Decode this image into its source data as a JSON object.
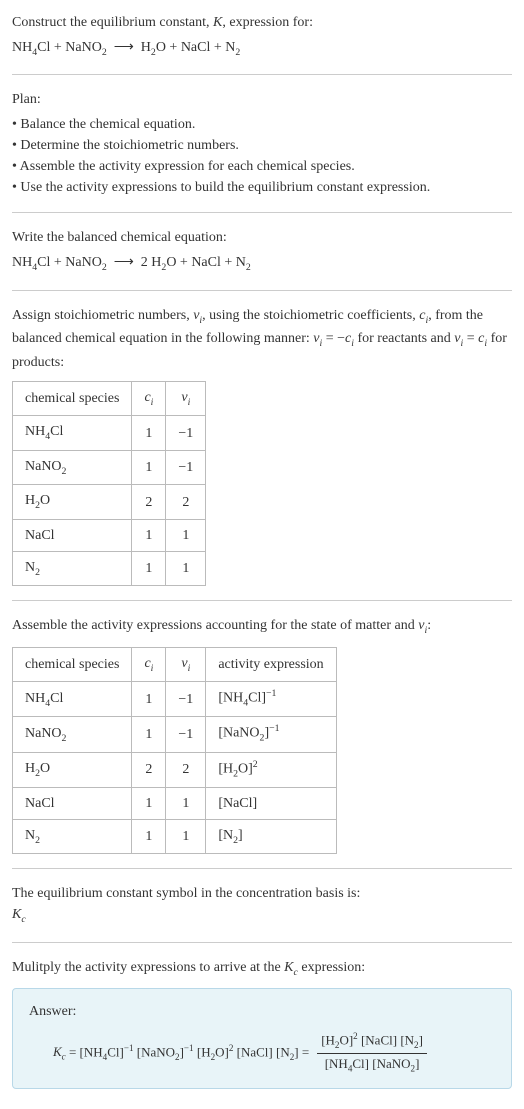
{
  "intro": {
    "line1": "Construct the equilibrium constant, ",
    "kvar": "K",
    "line1b": ", expression for:",
    "equation_html": "NH<sub>4</sub>Cl + NaNO<sub>2</sub> &nbsp;⟶&nbsp; H<sub>2</sub>O + NaCl + N<sub>2</sub>"
  },
  "plan": {
    "title": "Plan:",
    "items": [
      "Balance the chemical equation.",
      "Determine the stoichiometric numbers.",
      "Assemble the activity expression for each chemical species.",
      "Use the activity expressions to build the equilibrium constant expression."
    ]
  },
  "balanced": {
    "title": "Write the balanced chemical equation:",
    "equation_html": "NH<sub>4</sub>Cl + NaNO<sub>2</sub> &nbsp;⟶&nbsp; 2 H<sub>2</sub>O + NaCl + N<sub>2</sub>"
  },
  "stoich": {
    "text_html": "Assign stoichiometric numbers, <i>ν<sub>i</sub></i>, using the stoichiometric coefficients, <i>c<sub>i</sub></i>, from the balanced chemical equation in the following manner: <i>ν<sub>i</sub></i> = −<i>c<sub>i</sub></i> for reactants and <i>ν<sub>i</sub></i> = <i>c<sub>i</sub></i> for products:",
    "headers": {
      "species": "chemical species",
      "ci_html": "<i>c<sub>i</sub></i>",
      "vi_html": "<i>ν<sub>i</sub></i>"
    },
    "rows": [
      {
        "species_html": "NH<sub>4</sub>Cl",
        "ci": "1",
        "vi": "−1"
      },
      {
        "species_html": "NaNO<sub>2</sub>",
        "ci": "1",
        "vi": "−1"
      },
      {
        "species_html": "H<sub>2</sub>O",
        "ci": "2",
        "vi": "2"
      },
      {
        "species_html": "NaCl",
        "ci": "1",
        "vi": "1"
      },
      {
        "species_html": "N<sub>2</sub>",
        "ci": "1",
        "vi": "1"
      }
    ]
  },
  "activity": {
    "text_html": "Assemble the activity expressions accounting for the state of matter and <i>ν<sub>i</sub></i>:",
    "headers": {
      "species": "chemical species",
      "ci_html": "<i>c<sub>i</sub></i>",
      "vi_html": "<i>ν<sub>i</sub></i>",
      "activity": "activity expression"
    },
    "rows": [
      {
        "species_html": "NH<sub>4</sub>Cl",
        "ci": "1",
        "vi": "−1",
        "expr_html": "[NH<sub>4</sub>Cl]<sup>−1</sup>"
      },
      {
        "species_html": "NaNO<sub>2</sub>",
        "ci": "1",
        "vi": "−1",
        "expr_html": "[NaNO<sub>2</sub>]<sup>−1</sup>"
      },
      {
        "species_html": "H<sub>2</sub>O",
        "ci": "2",
        "vi": "2",
        "expr_html": "[H<sub>2</sub>O]<sup>2</sup>"
      },
      {
        "species_html": "NaCl",
        "ci": "1",
        "vi": "1",
        "expr_html": "[NaCl]"
      },
      {
        "species_html": "N<sub>2</sub>",
        "ci": "1",
        "vi": "1",
        "expr_html": "[N<sub>2</sub>]"
      }
    ]
  },
  "symbol": {
    "text": "The equilibrium constant symbol in the concentration basis is:",
    "kc_html": "<i>K<sub>c</sub></i>"
  },
  "final": {
    "text_html": "Mulitply the activity expressions to arrive at the <i>K<sub>c</sub></i> expression:",
    "answer_label": "Answer:",
    "lhs_html": "<i>K<sub>c</sub></i> = [NH<sub>4</sub>Cl]<sup>−1</sup> [NaNO<sub>2</sub>]<sup>−1</sup> [H<sub>2</sub>O]<sup>2</sup> [NaCl] [N<sub>2</sub>] =",
    "num_html": "[H<sub>2</sub>O]<sup>2</sup> [NaCl] [N<sub>2</sub>]",
    "den_html": "[NH<sub>4</sub>Cl] [NaNO<sub>2</sub>]"
  }
}
